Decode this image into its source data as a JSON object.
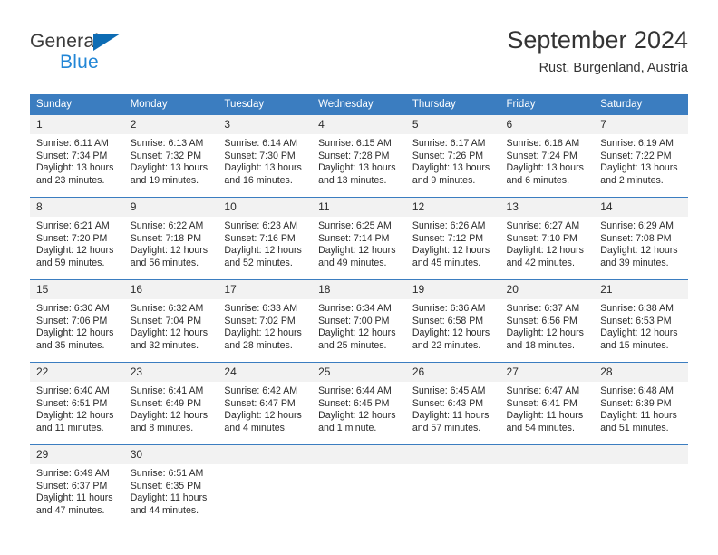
{
  "brand": {
    "name_top": "General",
    "name_bottom": "Blue",
    "accent_color": "#0d6cb4",
    "accent_color_light": "#2286d6"
  },
  "header": {
    "title": "September 2024",
    "subtitle": "Rust, Burgenland, Austria"
  },
  "calendar": {
    "header_bg": "#3b7dc0",
    "daynum_bg": "#f2f2f2",
    "weekdays": [
      "Sunday",
      "Monday",
      "Tuesday",
      "Wednesday",
      "Thursday",
      "Friday",
      "Saturday"
    ],
    "weeks": [
      [
        {
          "day": "1",
          "sunrise": "Sunrise: 6:11 AM",
          "sunset": "Sunset: 7:34 PM",
          "daylight_1": "Daylight: 13 hours",
          "daylight_2": "and 23 minutes."
        },
        {
          "day": "2",
          "sunrise": "Sunrise: 6:13 AM",
          "sunset": "Sunset: 7:32 PM",
          "daylight_1": "Daylight: 13 hours",
          "daylight_2": "and 19 minutes."
        },
        {
          "day": "3",
          "sunrise": "Sunrise: 6:14 AM",
          "sunset": "Sunset: 7:30 PM",
          "daylight_1": "Daylight: 13 hours",
          "daylight_2": "and 16 minutes."
        },
        {
          "day": "4",
          "sunrise": "Sunrise: 6:15 AM",
          "sunset": "Sunset: 7:28 PM",
          "daylight_1": "Daylight: 13 hours",
          "daylight_2": "and 13 minutes."
        },
        {
          "day": "5",
          "sunrise": "Sunrise: 6:17 AM",
          "sunset": "Sunset: 7:26 PM",
          "daylight_1": "Daylight: 13 hours",
          "daylight_2": "and 9 minutes."
        },
        {
          "day": "6",
          "sunrise": "Sunrise: 6:18 AM",
          "sunset": "Sunset: 7:24 PM",
          "daylight_1": "Daylight: 13 hours",
          "daylight_2": "and 6 minutes."
        },
        {
          "day": "7",
          "sunrise": "Sunrise: 6:19 AM",
          "sunset": "Sunset: 7:22 PM",
          "daylight_1": "Daylight: 13 hours",
          "daylight_2": "and 2 minutes."
        }
      ],
      [
        {
          "day": "8",
          "sunrise": "Sunrise: 6:21 AM",
          "sunset": "Sunset: 7:20 PM",
          "daylight_1": "Daylight: 12 hours",
          "daylight_2": "and 59 minutes."
        },
        {
          "day": "9",
          "sunrise": "Sunrise: 6:22 AM",
          "sunset": "Sunset: 7:18 PM",
          "daylight_1": "Daylight: 12 hours",
          "daylight_2": "and 56 minutes."
        },
        {
          "day": "10",
          "sunrise": "Sunrise: 6:23 AM",
          "sunset": "Sunset: 7:16 PM",
          "daylight_1": "Daylight: 12 hours",
          "daylight_2": "and 52 minutes."
        },
        {
          "day": "11",
          "sunrise": "Sunrise: 6:25 AM",
          "sunset": "Sunset: 7:14 PM",
          "daylight_1": "Daylight: 12 hours",
          "daylight_2": "and 49 minutes."
        },
        {
          "day": "12",
          "sunrise": "Sunrise: 6:26 AM",
          "sunset": "Sunset: 7:12 PM",
          "daylight_1": "Daylight: 12 hours",
          "daylight_2": "and 45 minutes."
        },
        {
          "day": "13",
          "sunrise": "Sunrise: 6:27 AM",
          "sunset": "Sunset: 7:10 PM",
          "daylight_1": "Daylight: 12 hours",
          "daylight_2": "and 42 minutes."
        },
        {
          "day": "14",
          "sunrise": "Sunrise: 6:29 AM",
          "sunset": "Sunset: 7:08 PM",
          "daylight_1": "Daylight: 12 hours",
          "daylight_2": "and 39 minutes."
        }
      ],
      [
        {
          "day": "15",
          "sunrise": "Sunrise: 6:30 AM",
          "sunset": "Sunset: 7:06 PM",
          "daylight_1": "Daylight: 12 hours",
          "daylight_2": "and 35 minutes."
        },
        {
          "day": "16",
          "sunrise": "Sunrise: 6:32 AM",
          "sunset": "Sunset: 7:04 PM",
          "daylight_1": "Daylight: 12 hours",
          "daylight_2": "and 32 minutes."
        },
        {
          "day": "17",
          "sunrise": "Sunrise: 6:33 AM",
          "sunset": "Sunset: 7:02 PM",
          "daylight_1": "Daylight: 12 hours",
          "daylight_2": "and 28 minutes."
        },
        {
          "day": "18",
          "sunrise": "Sunrise: 6:34 AM",
          "sunset": "Sunset: 7:00 PM",
          "daylight_1": "Daylight: 12 hours",
          "daylight_2": "and 25 minutes."
        },
        {
          "day": "19",
          "sunrise": "Sunrise: 6:36 AM",
          "sunset": "Sunset: 6:58 PM",
          "daylight_1": "Daylight: 12 hours",
          "daylight_2": "and 22 minutes."
        },
        {
          "day": "20",
          "sunrise": "Sunrise: 6:37 AM",
          "sunset": "Sunset: 6:56 PM",
          "daylight_1": "Daylight: 12 hours",
          "daylight_2": "and 18 minutes."
        },
        {
          "day": "21",
          "sunrise": "Sunrise: 6:38 AM",
          "sunset": "Sunset: 6:53 PM",
          "daylight_1": "Daylight: 12 hours",
          "daylight_2": "and 15 minutes."
        }
      ],
      [
        {
          "day": "22",
          "sunrise": "Sunrise: 6:40 AM",
          "sunset": "Sunset: 6:51 PM",
          "daylight_1": "Daylight: 12 hours",
          "daylight_2": "and 11 minutes."
        },
        {
          "day": "23",
          "sunrise": "Sunrise: 6:41 AM",
          "sunset": "Sunset: 6:49 PM",
          "daylight_1": "Daylight: 12 hours",
          "daylight_2": "and 8 minutes."
        },
        {
          "day": "24",
          "sunrise": "Sunrise: 6:42 AM",
          "sunset": "Sunset: 6:47 PM",
          "daylight_1": "Daylight: 12 hours",
          "daylight_2": "and 4 minutes."
        },
        {
          "day": "25",
          "sunrise": "Sunrise: 6:44 AM",
          "sunset": "Sunset: 6:45 PM",
          "daylight_1": "Daylight: 12 hours",
          "daylight_2": "and 1 minute."
        },
        {
          "day": "26",
          "sunrise": "Sunrise: 6:45 AM",
          "sunset": "Sunset: 6:43 PM",
          "daylight_1": "Daylight: 11 hours",
          "daylight_2": "and 57 minutes."
        },
        {
          "day": "27",
          "sunrise": "Sunrise: 6:47 AM",
          "sunset": "Sunset: 6:41 PM",
          "daylight_1": "Daylight: 11 hours",
          "daylight_2": "and 54 minutes."
        },
        {
          "day": "28",
          "sunrise": "Sunrise: 6:48 AM",
          "sunset": "Sunset: 6:39 PM",
          "daylight_1": "Daylight: 11 hours",
          "daylight_2": "and 51 minutes."
        }
      ],
      [
        {
          "day": "29",
          "sunrise": "Sunrise: 6:49 AM",
          "sunset": "Sunset: 6:37 PM",
          "daylight_1": "Daylight: 11 hours",
          "daylight_2": "and 47 minutes."
        },
        {
          "day": "30",
          "sunrise": "Sunrise: 6:51 AM",
          "sunset": "Sunset: 6:35 PM",
          "daylight_1": "Daylight: 11 hours",
          "daylight_2": "and 44 minutes."
        },
        {
          "day": "",
          "sunrise": "",
          "sunset": "",
          "daylight_1": "",
          "daylight_2": ""
        },
        {
          "day": "",
          "sunrise": "",
          "sunset": "",
          "daylight_1": "",
          "daylight_2": ""
        },
        {
          "day": "",
          "sunrise": "",
          "sunset": "",
          "daylight_1": "",
          "daylight_2": ""
        },
        {
          "day": "",
          "sunrise": "",
          "sunset": "",
          "daylight_1": "",
          "daylight_2": ""
        },
        {
          "day": "",
          "sunrise": "",
          "sunset": "",
          "daylight_1": "",
          "daylight_2": ""
        }
      ]
    ]
  }
}
